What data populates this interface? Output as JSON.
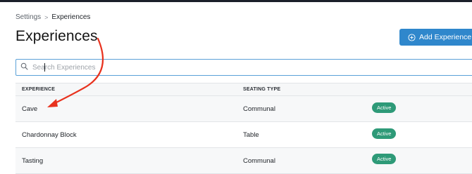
{
  "breadcrumb": {
    "parent": "Settings",
    "separator": ">",
    "current": "Experiences"
  },
  "page_title": "Experiences",
  "add_button": {
    "label": "Add Experience",
    "icon": "plus-circle-icon"
  },
  "search": {
    "placeholder": "Search Experiences",
    "value": "",
    "icon": "search-icon"
  },
  "table": {
    "columns": [
      "EXPERIENCE",
      "SEATING TYPE"
    ],
    "rows": [
      {
        "experience": "Cave",
        "seating_type": "Communal",
        "status": "Active"
      },
      {
        "experience": "Chardonnay Block",
        "seating_type": "Table",
        "status": "Active"
      },
      {
        "experience": "Tasting",
        "seating_type": "Communal",
        "status": "Active"
      }
    ]
  },
  "colors": {
    "primary_button": "#2f87cc",
    "status_active": "#2e9a78",
    "annotation_arrow": "#e8321e",
    "search_focus_border": "#5aa1d8"
  }
}
